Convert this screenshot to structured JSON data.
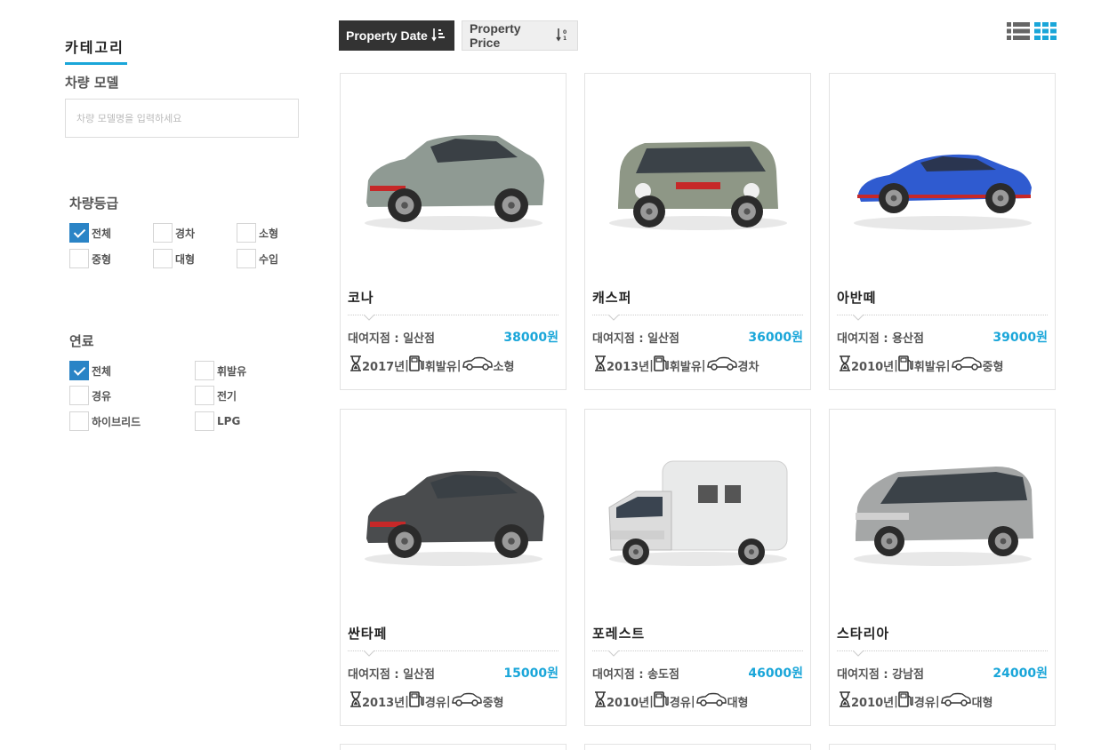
{
  "sidebar": {
    "category_title": "카테고리",
    "model_label": "차량 모델",
    "model_placeholder": "차량 모델명을 입력하세요",
    "grade": {
      "title": "차량등급",
      "options": [
        {
          "label": "전체",
          "checked": true
        },
        {
          "label": "경차",
          "checked": false
        },
        {
          "label": "소형",
          "checked": false
        },
        {
          "label": "중형",
          "checked": false
        },
        {
          "label": "대형",
          "checked": false
        },
        {
          "label": "수입",
          "checked": false
        }
      ]
    },
    "fuel": {
      "title": "연료",
      "options": [
        {
          "label": "전체",
          "checked": true
        },
        {
          "label": "휘발유",
          "checked": false
        },
        {
          "label": "경유",
          "checked": false
        },
        {
          "label": "전기",
          "checked": false
        },
        {
          "label": "하이브리드",
          "checked": false
        },
        {
          "label": "LPG",
          "checked": false
        }
      ]
    }
  },
  "toolbar": {
    "sort_date_label": "Property Date",
    "sort_price_label": "Property Price",
    "active_sort": "date",
    "view_mode": "grid"
  },
  "colors": {
    "accent": "#1aa6d9",
    "checkbox_checked": "#2a84c6",
    "active_sort_bg": "#333333"
  },
  "cars": [
    {
      "name": "코나",
      "branch": "대여지점 : 일산점",
      "price": "38000원",
      "year": "2017년",
      "fuel": "휘발유",
      "size": "소형",
      "body": "suv",
      "color": "#8f9a93"
    },
    {
      "name": "캐스퍼",
      "branch": "대여지점 : 일산점",
      "price": "36000원",
      "year": "2013년",
      "fuel": "휘발유",
      "size": "경차",
      "body": "mini",
      "color": "#8e9786"
    },
    {
      "name": "아반떼",
      "branch": "대여지점 : 용산점",
      "price": "39000원",
      "year": "2010년",
      "fuel": "휘발유",
      "size": "중형",
      "body": "sedan",
      "color": "#2f5bd0"
    },
    {
      "name": "싼타페",
      "branch": "대여지점 : 일산점",
      "price": "15000원",
      "year": "2013년",
      "fuel": "경유",
      "size": "중형",
      "body": "suv",
      "color": "#4a4c4e"
    },
    {
      "name": "포레스트",
      "branch": "대여지점 : 송도점",
      "price": "46000원",
      "year": "2010년",
      "fuel": "경유",
      "size": "대형",
      "body": "camper",
      "color": "#e9eaea"
    },
    {
      "name": "스타리아",
      "branch": "대여지점 : 강남점",
      "price": "24000원",
      "year": "2010년",
      "fuel": "경유",
      "size": "대형",
      "body": "van",
      "color": "#a5a7a7"
    }
  ],
  "separator": "|"
}
